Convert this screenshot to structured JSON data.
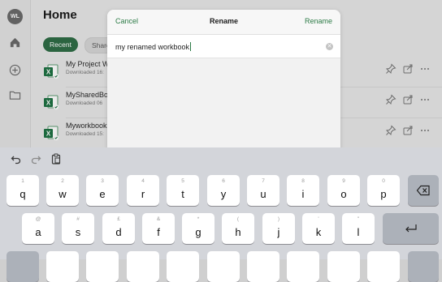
{
  "user": {
    "initials": "WL"
  },
  "home": {
    "title": "Home"
  },
  "rail": {
    "icons": [
      "home-icon",
      "add-circle-icon",
      "folder-icon"
    ]
  },
  "filters": {
    "recent_label": "Recent",
    "shared_label": "Share"
  },
  "files": [
    {
      "name": "My Project W",
      "sub": "Downloaded 16:"
    },
    {
      "name": "MySharedBo",
      "sub": "Downloaded 06"
    },
    {
      "name": "Myworkbook",
      "sub": "Downloaded 15:"
    }
  ],
  "row_action_icons": [
    "pin-icon",
    "share-icon",
    "more-icon"
  ],
  "dialog": {
    "cancel_label": "Cancel",
    "title": "Rename",
    "rename_label": "Rename",
    "input_value": "my renamed workbook"
  },
  "keyboard": {
    "toolbar_icons": [
      "undo-icon",
      "redo-icon",
      "paste-icon"
    ],
    "row1": [
      {
        "main": "q",
        "sub": "1"
      },
      {
        "main": "w",
        "sub": "2"
      },
      {
        "main": "e",
        "sub": "3"
      },
      {
        "main": "r",
        "sub": "4"
      },
      {
        "main": "t",
        "sub": "5"
      },
      {
        "main": "y",
        "sub": "6"
      },
      {
        "main": "u",
        "sub": "7"
      },
      {
        "main": "i",
        "sub": "8"
      },
      {
        "main": "o",
        "sub": "9"
      },
      {
        "main": "p",
        "sub": "0"
      }
    ],
    "row2": [
      {
        "main": "a",
        "sub": "@"
      },
      {
        "main": "s",
        "sub": "#"
      },
      {
        "main": "d",
        "sub": "£"
      },
      {
        "main": "f",
        "sub": "&"
      },
      {
        "main": "g",
        "sub": "*"
      },
      {
        "main": "h",
        "sub": "("
      },
      {
        "main": "j",
        "sub": ")"
      },
      {
        "main": "k",
        "sub": "'"
      },
      {
        "main": "l",
        "sub": "\""
      }
    ]
  },
  "colors": {
    "accent": "#2b7a45",
    "recent_chip": "#2f6d46",
    "keyboard_bg": "#d3d5da"
  }
}
